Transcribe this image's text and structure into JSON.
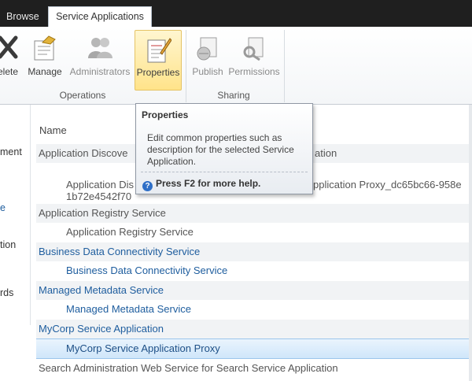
{
  "tabs": {
    "browse": "Browse",
    "active": "Service Applications"
  },
  "ribbon": {
    "buttons": [
      {
        "label": "elete",
        "icon": "delete-x-icon"
      },
      {
        "label": "Manage",
        "icon": "manage-icon"
      },
      {
        "label": "Administrators",
        "icon": "administrators-icon"
      },
      {
        "label": "Properties",
        "icon": "properties-icon"
      },
      {
        "label": "Publish",
        "icon": "publish-icon"
      },
      {
        "label": "Permissions",
        "icon": "permissions-icon"
      }
    ],
    "groups": {
      "operations": "Operations",
      "sharing": "Sharing"
    }
  },
  "leftnav": {
    "items": [
      "ment",
      "e",
      "tion",
      "rds"
    ]
  },
  "list": {
    "column_header": "Name",
    "rows": [
      {
        "text": "Application Discove",
        "trailing": "ation"
      },
      {
        "text": "Application Dis",
        "second_line": "1b72e4542f70",
        "trailing": "pplication Proxy_dc65bc66-958e"
      },
      {
        "text": "Application Registry Service"
      },
      {
        "text": "Application Registry Service"
      },
      {
        "text": "Business Data Connectivity Service"
      },
      {
        "text": "Business Data Connectivity Service"
      },
      {
        "text": "Managed Metadata Service"
      },
      {
        "text": "Managed Metadata Service"
      },
      {
        "text": "MyCorp Service Application"
      },
      {
        "text": "MyCorp Service Application Proxy"
      },
      {
        "text": "Search Administration Web Service for Search Service Application"
      }
    ]
  },
  "tooltip": {
    "title": "Properties",
    "description": "Edit common properties such as description for the selected Service Application.",
    "help": "Press F2 for more help."
  },
  "colors": {
    "link": "#1e5d9e",
    "ribbon_hover": "#ffe38a",
    "top_bar": "#1f1f1f"
  }
}
